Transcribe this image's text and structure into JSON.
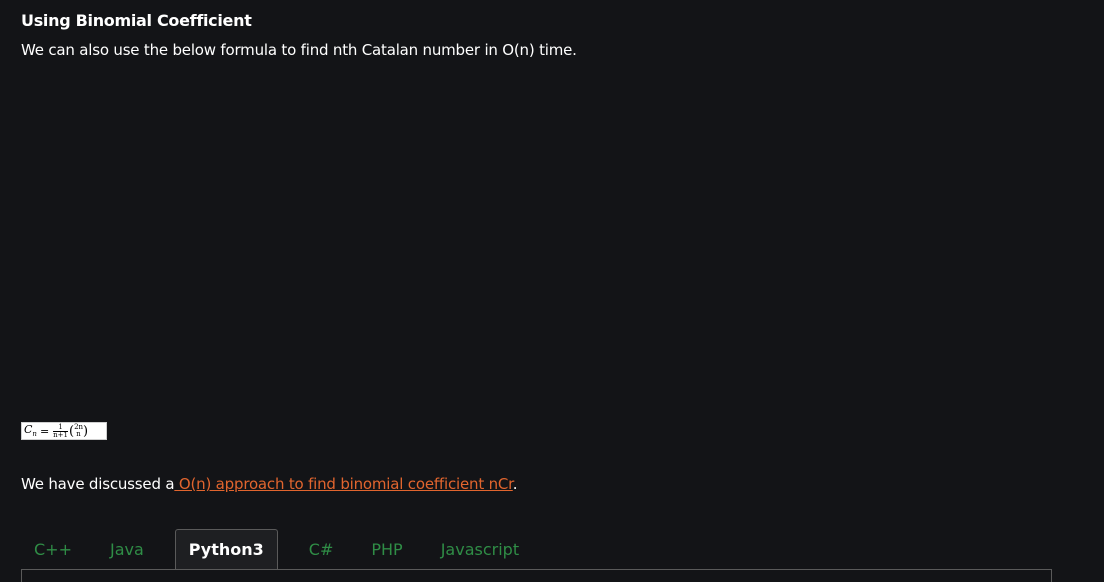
{
  "section": {
    "heading": "Using Binomial Coefficient",
    "intro": "We can also use the below formula to find nth Catalan number in O(n) time."
  },
  "formula": {
    "lhs": "C",
    "lhs_sub": "n",
    "equals": "=",
    "frac_num": "1",
    "frac_den": "n+1",
    "binom_top": "2n",
    "binom_bottom": "n"
  },
  "discussed": {
    "prefix": "We have discussed a",
    "link_text": " O(n) approach to find binomial coefficient nCr",
    "suffix": "."
  },
  "tabs": [
    {
      "label": "C++"
    },
    {
      "label": "Java"
    },
    {
      "label": "Python3"
    },
    {
      "label": "C#"
    },
    {
      "label": "PHP"
    },
    {
      "label": "Javascript"
    }
  ],
  "active_tab": "Python3",
  "colors": {
    "background": "#131417",
    "link": "#e1652e",
    "tab_inactive": "#2f8d46",
    "tab_active_bg": "#1e1f22"
  }
}
